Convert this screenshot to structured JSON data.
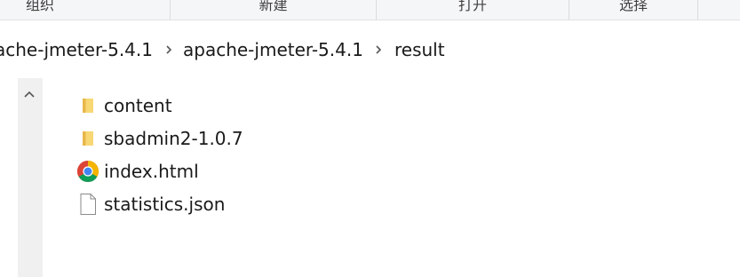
{
  "ribbon": {
    "groups": [
      {
        "label": "组织"
      },
      {
        "label": "新建"
      },
      {
        "label": "打开"
      },
      {
        "label": "选择"
      }
    ]
  },
  "address_bar": {
    "crumbs": [
      {
        "label": "ache-jmeter-5.4.1"
      },
      {
        "label": "apache-jmeter-5.4.1"
      },
      {
        "label": "result"
      }
    ]
  },
  "files": [
    {
      "name": "content",
      "icon": "folder-icon"
    },
    {
      "name": "sbadmin2-1.0.7",
      "icon": "folder-icon"
    },
    {
      "name": "index.html",
      "icon": "chrome-icon"
    },
    {
      "name": "statistics.json",
      "icon": "file-icon"
    }
  ],
  "colors": {
    "folder": "#f8d775",
    "folder_dark": "#e8b84a",
    "chrome_red": "#db4437",
    "chrome_yellow": "#f4b400",
    "chrome_green": "#0f9d58",
    "chrome_blue": "#4285f4"
  }
}
